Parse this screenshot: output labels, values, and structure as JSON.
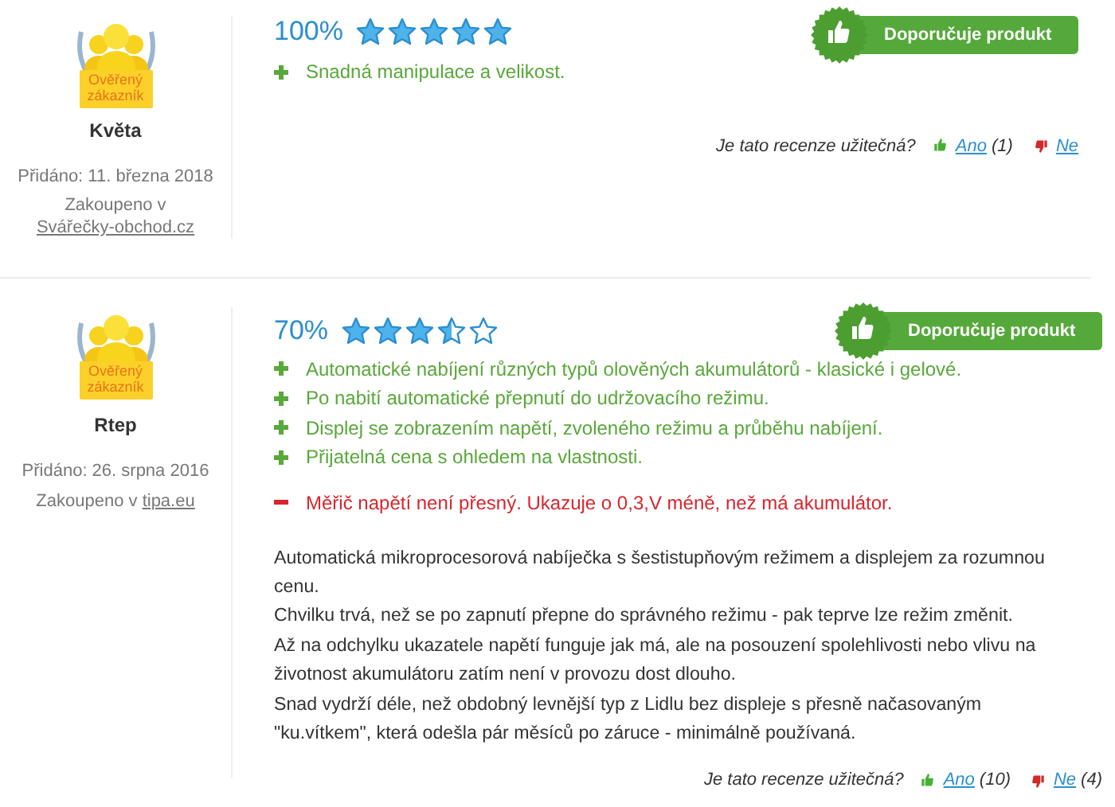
{
  "reviews": [
    {
      "author": "Květa",
      "badge_label": "Ověřený zákazník",
      "added": "Přidáno: 11. března 2018",
      "purchased_label": "Zakoupeno v",
      "store": "Svářečky-obchod.cz",
      "percent": "100%",
      "stars": 5,
      "recommend": "Doporučuje produkt",
      "pros": [
        "Snadná manipulace a velikost."
      ],
      "helpful": {
        "question": "Je tato recenze užitečná?",
        "yes": "Ano",
        "yes_count": "(1)",
        "no": "Ne"
      }
    },
    {
      "author": "Rtep",
      "badge_label": "Ověřený zákazník",
      "added": "Přidáno: 26. srpna 2016",
      "purchased_label": "Zakoupeno v",
      "store": "tipa.eu",
      "percent": "70%",
      "stars": 3.5,
      "recommend": "Doporučuje produkt",
      "pros": [
        "Automatické nabíjení různých typů olověných akumulátorů - klasické i gelové.",
        "Po nabití automatické přepnutí do udržovacího režimu.",
        "Displej se zobrazením napětí, zvoleného režimu a průběhu nabíjení.",
        "Přijatelná cena s ohledem na vlastnosti."
      ],
      "cons": [
        "Měřič napětí není přesný. Ukazuje o 0,3,V méně, než má akumulátor."
      ],
      "body": [
        "Automatická mikroprocesorová nabíječka s šestistupňovým režimem a displejem za rozumnou cenu.",
        "Chvilku trvá, než se po zapnutí přepne do správného režimu - pak teprve lze režim změnit.",
        "Až na odchylku ukazatele napětí funguje jak má, ale na posouzení spolehlivosti nebo vlivu na životnost akumulátoru zatím není v provozu dost dlouho.",
        "Snad vydrží déle, než obdobný levnější typ z Lidlu bez displeje s přesně načasovaným \"ku.vítkem\", která odešla pár měsíců po záruce - minimálně používaná."
      ],
      "helpful": {
        "question": "Je tato recenze užitečná?",
        "yes": "Ano",
        "yes_count": "(10)",
        "no": "Ne",
        "no_count": "(4)"
      }
    }
  ]
}
